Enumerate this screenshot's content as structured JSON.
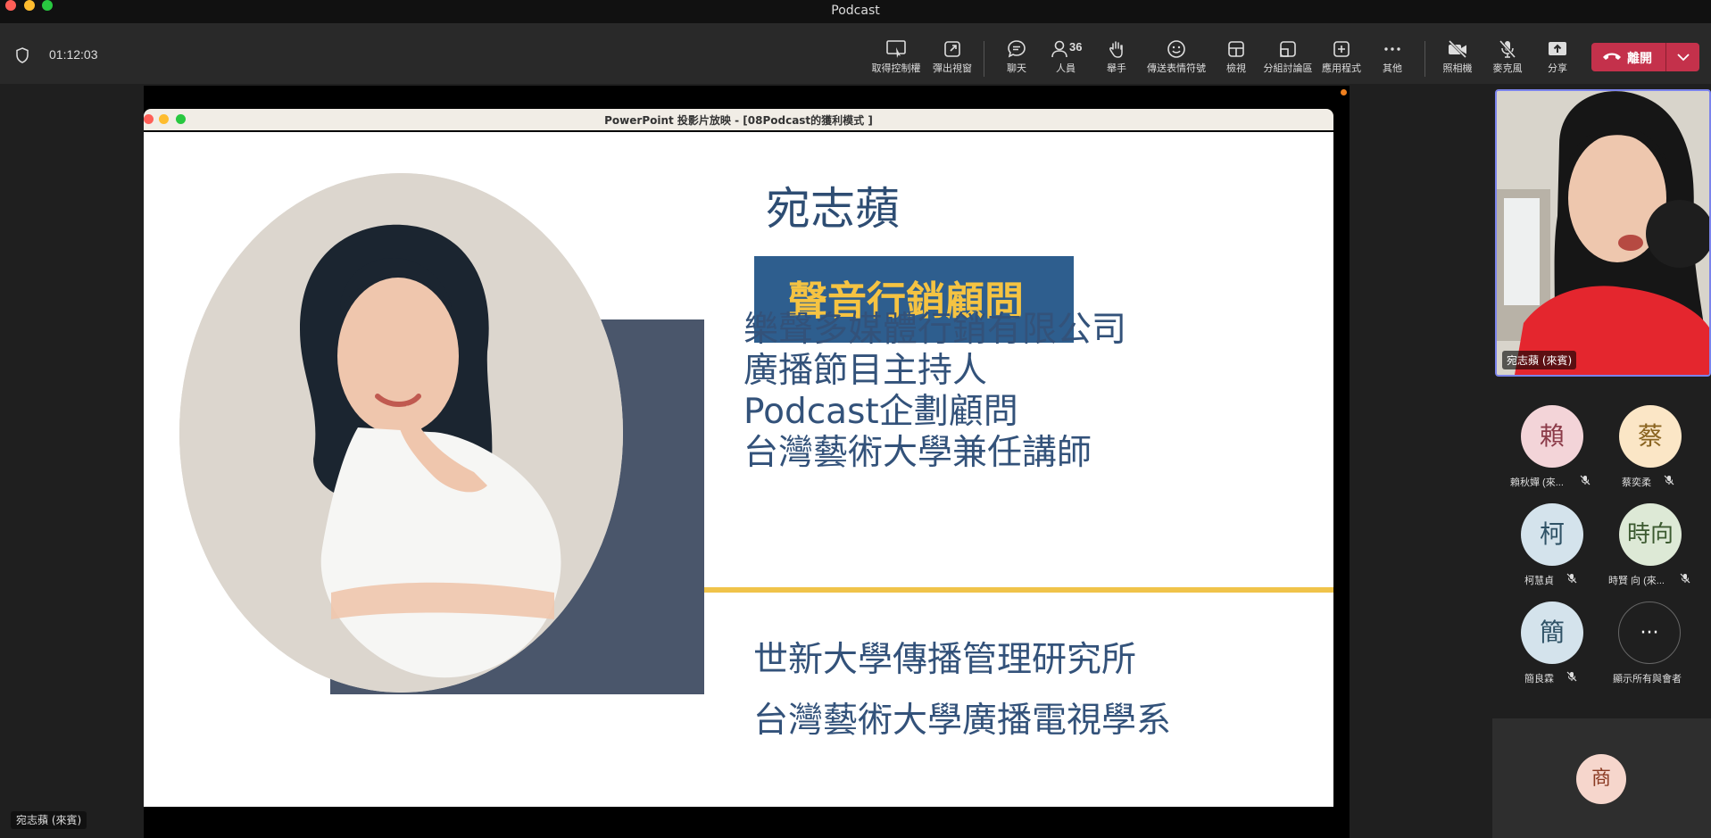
{
  "window": {
    "title": "Podcast"
  },
  "toolbar": {
    "timer": "01:12:03",
    "items": [
      {
        "label": "取得控制權",
        "icon": "request-control-icon"
      },
      {
        "label": "彈出視窗",
        "icon": "pop-out-icon"
      },
      {
        "label": "聊天",
        "icon": "chat-icon"
      },
      {
        "label": "人員",
        "icon": "people-icon",
        "count": "36"
      },
      {
        "label": "舉手",
        "icon": "raise-hand-icon"
      },
      {
        "label": "傳送表情符號",
        "icon": "emoji-icon"
      },
      {
        "label": "檢視",
        "icon": "view-icon"
      },
      {
        "label": "分組討論區",
        "icon": "breakout-rooms-icon"
      },
      {
        "label": "應用程式",
        "icon": "apps-icon"
      },
      {
        "label": "其他",
        "icon": "more-icon"
      },
      {
        "label": "照相機",
        "icon": "camera-off-icon"
      },
      {
        "label": "麥克風",
        "icon": "mic-off-icon"
      },
      {
        "label": "分享",
        "icon": "share-icon"
      }
    ],
    "leave_label": "離開"
  },
  "presentation": {
    "window_title": "PowerPoint 投影片放映 - [08Podcast的獲利模式 ]",
    "slide": {
      "name": "宛志蘋",
      "title": "聲音行銷顧問",
      "roles": [
        "樂聲多媒體行銷有限公司",
        "廣播節目主持人",
        "Podcast企劃顧問",
        "台灣藝術大學兼任講師"
      ],
      "education": [
        "世新大學傳播管理研究所",
        "台灣藝術大學廣播電視學系"
      ]
    },
    "presenter_label": "宛志蘋 (來賓)"
  },
  "video": {
    "label": "宛志蘋 (來賓)"
  },
  "participants": [
    {
      "initial": "賴",
      "name": "賴秋嬋 (來...",
      "bg": "#f3d4d8",
      "fg": "#8b3a48"
    },
    {
      "initial": "蔡",
      "name": "蔡奕柔",
      "bg": "#fbe6c6",
      "fg": "#8a6420"
    },
    {
      "initial": "柯",
      "name": "柯慧貞",
      "bg": "#d4e3ec",
      "fg": "#2f5266"
    },
    {
      "initial": "時向",
      "name": "時賢 向 (來...",
      "bg": "#dde9d6",
      "fg": "#3c5a30"
    },
    {
      "initial": "簡",
      "name": "簡良霖",
      "bg": "#d4e3ec",
      "fg": "#2f5266"
    }
  ],
  "show_all_label": "顯示所有與會者",
  "overflow_participant": {
    "initial": "商",
    "bg": "#f6d6cc",
    "fg": "#8a3a22"
  }
}
